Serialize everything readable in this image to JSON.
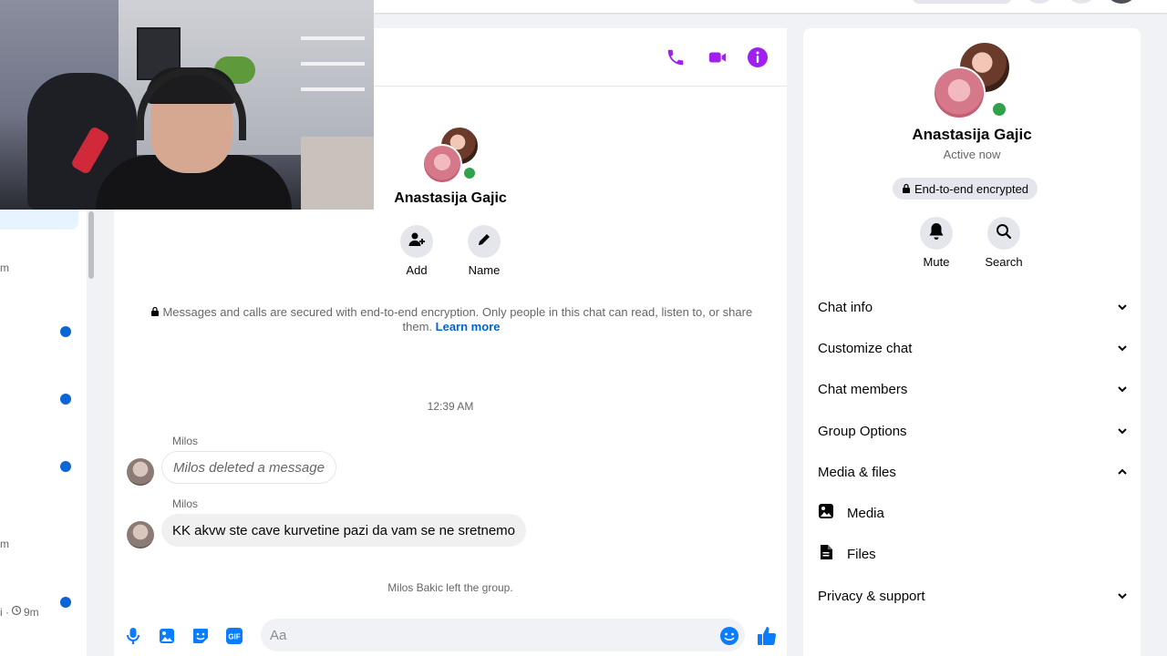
{
  "conversation": {
    "contact_name": "Anastasija Gajic",
    "actions": [
      {
        "label": "Add"
      },
      {
        "label": "Name"
      }
    ],
    "encryption_notice": "Messages and calls are secured with end-to-end encryption. Only people in this chat can read, listen to, or share them.",
    "learn_more": "Learn more",
    "timestamp": "12:39 AM",
    "messages": [
      {
        "sender": "Milos",
        "text": "Milos deleted a message"
      },
      {
        "sender": "Milos",
        "text": "KK akvw ste cave kurvetine pazi da vam se ne sretnemo"
      }
    ],
    "system_message": "Milos Bakic left the group.",
    "composer_placeholder": "Aa"
  },
  "left_list": {
    "metas": [
      "m",
      "m",
      "i ·",
      "9m"
    ]
  },
  "info_panel": {
    "name": "Anastasija Gajic",
    "status": "Active now",
    "encryption_badge": "End-to-end encrypted",
    "actions": [
      {
        "label": "Mute"
      },
      {
        "label": "Search"
      }
    ],
    "sections": [
      {
        "label": "Chat info"
      },
      {
        "label": "Customize chat"
      },
      {
        "label": "Chat members"
      },
      {
        "label": "Group Options"
      },
      {
        "label": "Media & files"
      },
      {
        "label": "Privacy & support"
      }
    ],
    "media_items": [
      {
        "label": "Media"
      },
      {
        "label": "Files"
      }
    ]
  },
  "colors": {
    "accent_purple": "#a020f0",
    "accent_blue": "#0a7cff",
    "online_green": "#31a24c",
    "unread_dot": "#0a66d6"
  }
}
